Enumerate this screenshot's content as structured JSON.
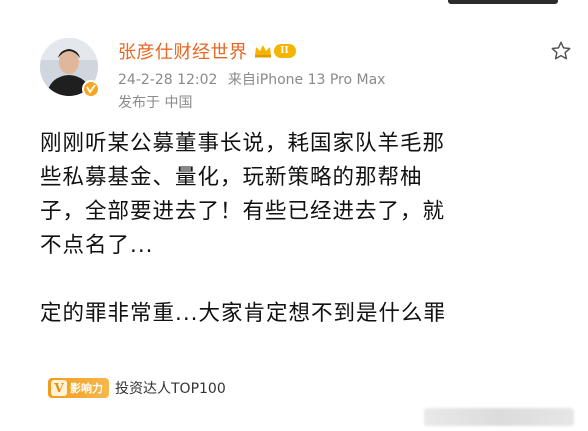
{
  "post": {
    "username": "张彦仕财经世界",
    "level_badge": "II",
    "timestamp": "24-2-28 12:02",
    "source": "来自iPhone 13 Pro Max",
    "location": "发布于 中国",
    "content_lines": [
      "刚刚听某公募董事长说，耗国家队羊毛那",
      "些私募基金、量化，玩新策略的那帮柚",
      "子，全部要进去了！有些已经进去了，就",
      "不点名了..."
    ],
    "content_line_last": "定的罪非常重...大家肯定想不到是什么罪",
    "tag": {
      "badge_text": "影响力",
      "badge_letter": "V",
      "label": "投资达人TOP100"
    }
  },
  "icons": {
    "favorite": "star-outline-icon",
    "verified": "verified-badge-icon",
    "crown": "crown-icon"
  },
  "colors": {
    "username": "#e86722",
    "meta": "#8a8a8a",
    "tag_badge": "#f29a1f"
  }
}
